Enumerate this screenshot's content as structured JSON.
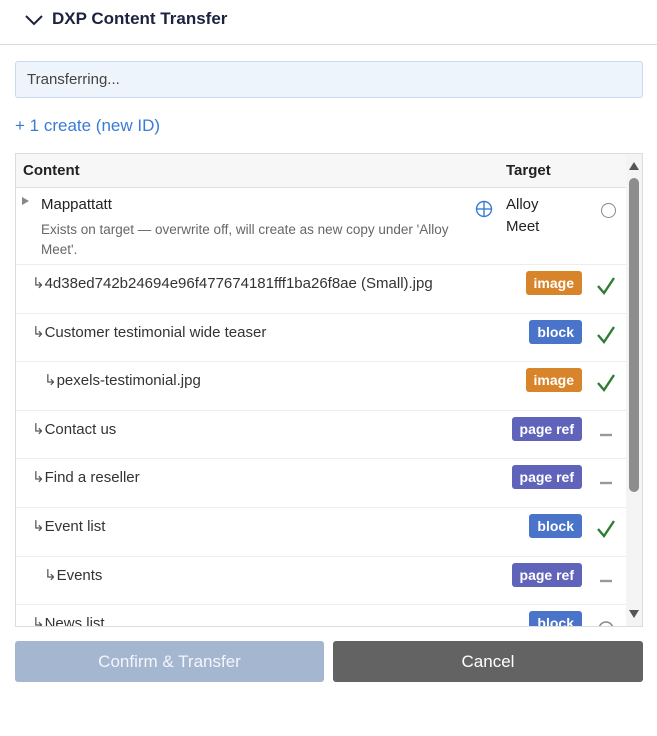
{
  "header": {
    "title": "DXP Content Transfer"
  },
  "status": {
    "text": "Transferring..."
  },
  "create_link": {
    "label": "+ 1 create (new ID)"
  },
  "table": {
    "columns": {
      "content": "Content",
      "target": "Target"
    },
    "first_row": {
      "name": "Mappattatt",
      "note": "Exists on target — overwrite off, will create as new copy under 'Alloy Meet'.",
      "target": "Alloy Meet"
    },
    "rows": [
      {
        "prefix": "↳",
        "name": "4d38ed742b24694e96f477674181fff1ba26f8ae (Small).jpg",
        "badge": "image",
        "status": "check"
      },
      {
        "prefix": "↳",
        "name": "Customer testimonial wide teaser",
        "badge": "block",
        "status": "check"
      },
      {
        "prefix": "↳",
        "name": "pexels-testimonial.jpg",
        "badge": "image",
        "status": "check"
      },
      {
        "prefix": "↳",
        "name": "Contact us",
        "badge": "page ref",
        "status": "dash"
      },
      {
        "prefix": "↳",
        "name": "Find a reseller",
        "badge": "page ref",
        "status": "dash"
      },
      {
        "prefix": "↳",
        "name": "Event list",
        "badge": "block",
        "status": "check"
      },
      {
        "prefix": "↳",
        "name": "Events",
        "badge": "page ref",
        "status": "dash"
      },
      {
        "prefix": "↳",
        "name": "News list",
        "badge": "block",
        "status": "radio"
      }
    ]
  },
  "buttons": {
    "confirm": "Confirm & Transfer",
    "cancel": "Cancel"
  },
  "colors": {
    "accent": "#3a7bd5",
    "badge_image": "#d8842b",
    "badge_block": "#4a74c9",
    "badge_page_ref": "#5f63ba",
    "check": "#2e7d32"
  }
}
